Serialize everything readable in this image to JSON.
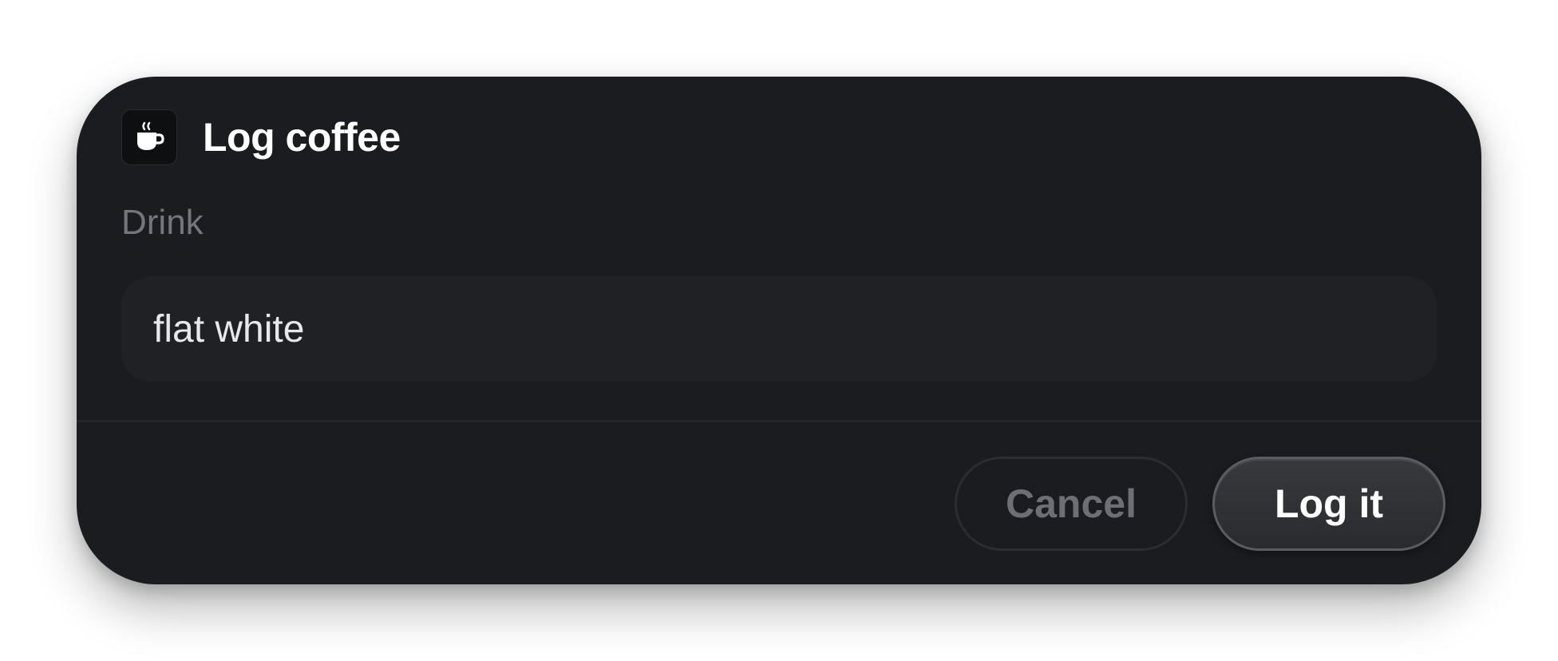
{
  "dialog": {
    "title": "Log coffee",
    "icon": "coffee-cup-icon"
  },
  "form": {
    "drink_label": "Drink",
    "drink_value": "flat white"
  },
  "actions": {
    "cancel_label": "Cancel",
    "submit_label": "Log it"
  },
  "colors": {
    "dialog_bg": "#1b1c1f",
    "input_bg": "#202124",
    "text_primary": "#ffffff",
    "text_muted": "#75767b"
  }
}
